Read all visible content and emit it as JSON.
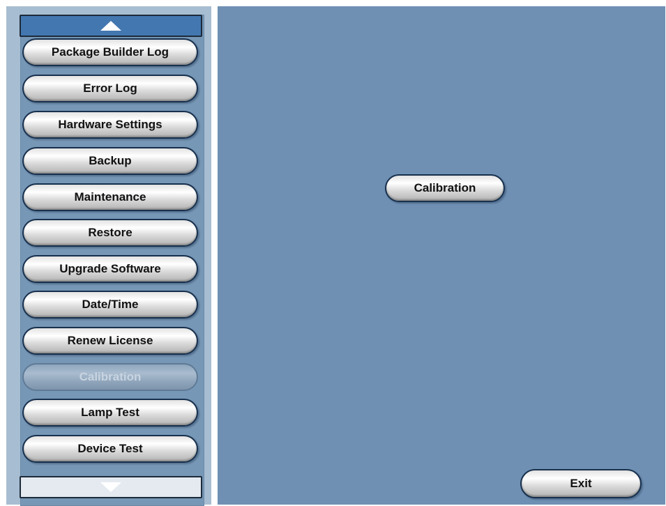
{
  "sidebar": {
    "items": [
      {
        "label": "Package Builder Log",
        "enabled": true
      },
      {
        "label": "Error Log",
        "enabled": true
      },
      {
        "label": "Hardware Settings",
        "enabled": true
      },
      {
        "label": "Backup",
        "enabled": true
      },
      {
        "label": "Maintenance",
        "enabled": true
      },
      {
        "label": "Restore",
        "enabled": true
      },
      {
        "label": "Upgrade Software",
        "enabled": true
      },
      {
        "label": "Date/Time",
        "enabled": true
      },
      {
        "label": "Renew License",
        "enabled": true
      },
      {
        "label": "Calibration",
        "enabled": false
      },
      {
        "label": "Lamp Test",
        "enabled": true
      },
      {
        "label": "Device Test",
        "enabled": true
      }
    ],
    "scroll_up_icon": "triangle-up-icon",
    "scroll_down_icon": "triangle-down-icon"
  },
  "main": {
    "calibration_label": "Calibration",
    "exit_label": "Exit"
  },
  "colors": {
    "main_background": "#6f90b3",
    "sidebar_background": "#7797b6",
    "sidebar_frame": "#a7bdd2",
    "scroll_up_background": "#4377b0",
    "button_border": "#17304d"
  }
}
